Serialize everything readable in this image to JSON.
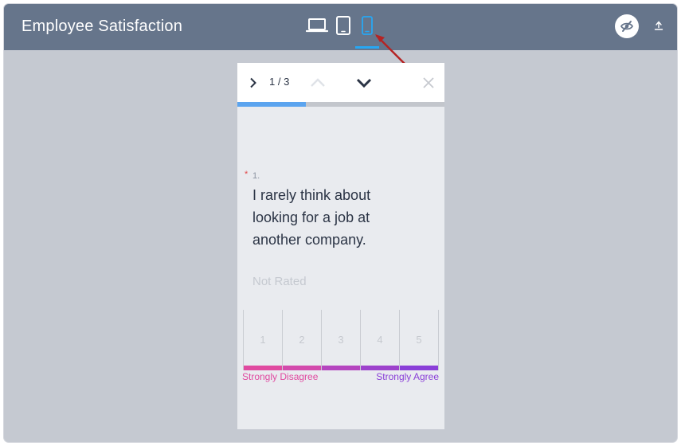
{
  "app": {
    "title": "Employee Satisfaction"
  },
  "toolbar": {
    "devices": [
      {
        "name": "desktop",
        "icon": "laptop-icon",
        "selected": false
      },
      {
        "name": "tablet",
        "icon": "tablet-icon",
        "selected": false
      },
      {
        "name": "phone",
        "icon": "phone-icon",
        "selected": true
      }
    ],
    "preview_toggle_icon": "eye-slash-icon",
    "export_icon": "upload-icon",
    "accent_color": "#27a7f3"
  },
  "preview": {
    "counter": "1 / 3",
    "progress_fraction": 0.33,
    "progress_color": "#5ba4ef",
    "question": {
      "required_marker": "*",
      "number": "1.",
      "text": "I rarely think about looking for a job at another company.",
      "status": "Not Rated"
    },
    "scale": {
      "options": [
        {
          "label": "1",
          "color": "#e04aa0"
        },
        {
          "label": "2",
          "color": "#d34aac"
        },
        {
          "label": "3",
          "color": "#b545bf"
        },
        {
          "label": "4",
          "color": "#9d42cc"
        },
        {
          "label": "5",
          "color": "#8a3fd8"
        }
      ],
      "low_label": "Strongly Disagree",
      "high_label": "Strongly Agree"
    }
  }
}
